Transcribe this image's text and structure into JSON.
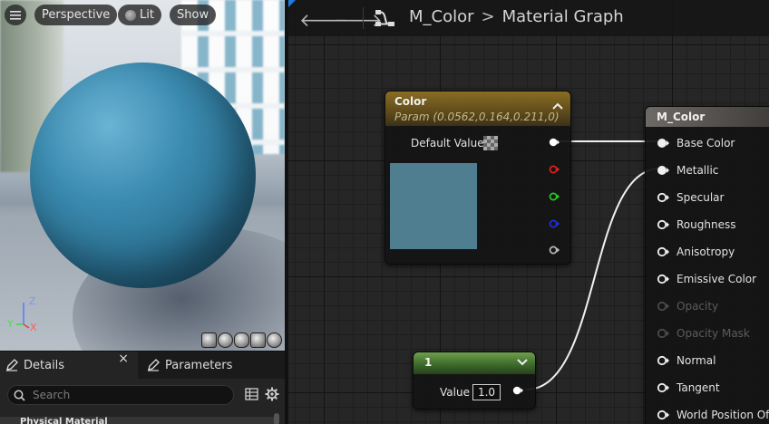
{
  "viewport": {
    "menu_icon": "hamburger-icon",
    "perspective_label": "Perspective",
    "lit_label": "Lit",
    "show_label": "Show",
    "axis_z": "Z",
    "axis_x": "X",
    "axis_y": "Y",
    "sphere_color": "#3b8bb0"
  },
  "details_panel": {
    "tab_details": "Details",
    "tab_close": "×",
    "tab_parameters": "Parameters",
    "search_placeholder": "Search",
    "section_header": "Physical Material"
  },
  "toolbar": {
    "breadcrumb_asset": "M_Color",
    "breadcrumb_separator": ">",
    "breadcrumb_graph": "Material Graph"
  },
  "color_node": {
    "title": "Color",
    "subtitle": "Param (0.0562,0.164,0.211,0)",
    "default_value_label": "Default Value",
    "swatch_color": "#4e7e90",
    "output_pins": [
      "white",
      "red",
      "green",
      "blue",
      "alpha"
    ]
  },
  "constant_node": {
    "title": "1",
    "value_label": "Value",
    "value": "1.0"
  },
  "material_node": {
    "title": "M_Color",
    "inputs": [
      {
        "label": "Base Color",
        "enabled": true,
        "connected": true
      },
      {
        "label": "Metallic",
        "enabled": true,
        "connected": true
      },
      {
        "label": "Specular",
        "enabled": true,
        "connected": false
      },
      {
        "label": "Roughness",
        "enabled": true,
        "connected": false
      },
      {
        "label": "Anisotropy",
        "enabled": true,
        "connected": false
      },
      {
        "label": "Emissive Color",
        "enabled": true,
        "connected": false
      },
      {
        "label": "Opacity",
        "enabled": false,
        "connected": false
      },
      {
        "label": "Opacity Mask",
        "enabled": false,
        "connected": false
      },
      {
        "label": "Normal",
        "enabled": true,
        "connected": false
      },
      {
        "label": "Tangent",
        "enabled": true,
        "connected": false
      },
      {
        "label": "World Position Offs",
        "enabled": true,
        "connected": false
      }
    ]
  },
  "colors": {
    "accent_blue": "#1e7be0",
    "param_node_header": "#8a6d23",
    "constant_node_header": "#6fa04c",
    "material_node_header": "#6d6a66"
  }
}
